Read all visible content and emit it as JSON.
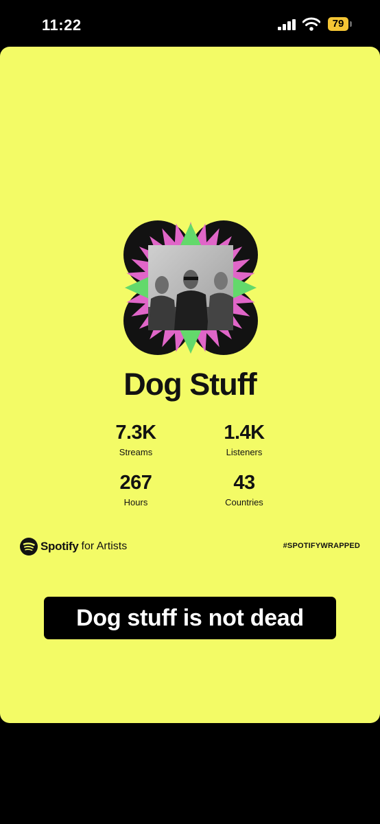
{
  "status_bar": {
    "time": "11:22",
    "battery_level": "79",
    "icons": [
      "cellular-signal-icon",
      "wifi-icon",
      "battery-icon"
    ]
  },
  "card": {
    "background_color": "#f3fb66",
    "artist_name": "Dog Stuff",
    "stats": [
      {
        "value": "7.3K",
        "label": "Streams"
      },
      {
        "value": "1.4K",
        "label": "Listeners"
      },
      {
        "value": "267",
        "label": "Hours"
      },
      {
        "value": "43",
        "label": "Countries"
      }
    ],
    "brand": {
      "name": "Spotify",
      "suffix": "for Artists",
      "icon": "spotify-logo-icon"
    },
    "hashtag": "#SPOTIFYWRAPPED",
    "artwork_colors": {
      "black": "#121212",
      "pink": "#e066c8",
      "green": "#63d96b"
    }
  },
  "caption": "Dog stuff is not dead"
}
